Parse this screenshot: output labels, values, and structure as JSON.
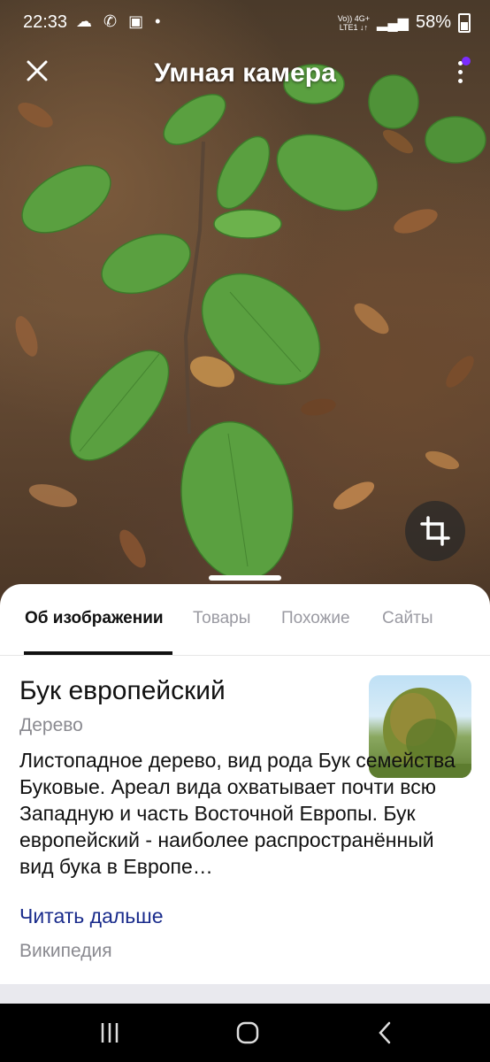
{
  "status_bar": {
    "time": "22:33",
    "notif_icons": "☁ ✆ ▣ •",
    "network_top": "Vo)) 4G+",
    "network_bottom": "LTE1 ↓↑",
    "battery": "58%"
  },
  "toolbar": {
    "title": "Умная камера",
    "close_icon": "close-icon",
    "menu_icon": "more-vertical-icon",
    "accent": "#7b2cff"
  },
  "tabs": [
    {
      "label": "Об изображении",
      "active": true
    },
    {
      "label": "Товары",
      "active": false
    },
    {
      "label": "Похожие",
      "active": false
    },
    {
      "label": "Сайты",
      "active": false
    }
  ],
  "result": {
    "title": "Бук европейский",
    "subtitle": "Дерево",
    "description": "Листопадное дерево, вид рода Бук семейства Буковые. Ареал вида охватывает почти всю Западную и часть Восточной Европы. Бук европейский - наиболее распространённый вид бука в Европе…",
    "read_more": "Читать дальше",
    "source": "Википедия",
    "link_color": "#1a2c8c"
  },
  "nav": {
    "recents_icon": "recents-icon",
    "home_icon": "home-icon",
    "back_icon": "back-icon"
  }
}
